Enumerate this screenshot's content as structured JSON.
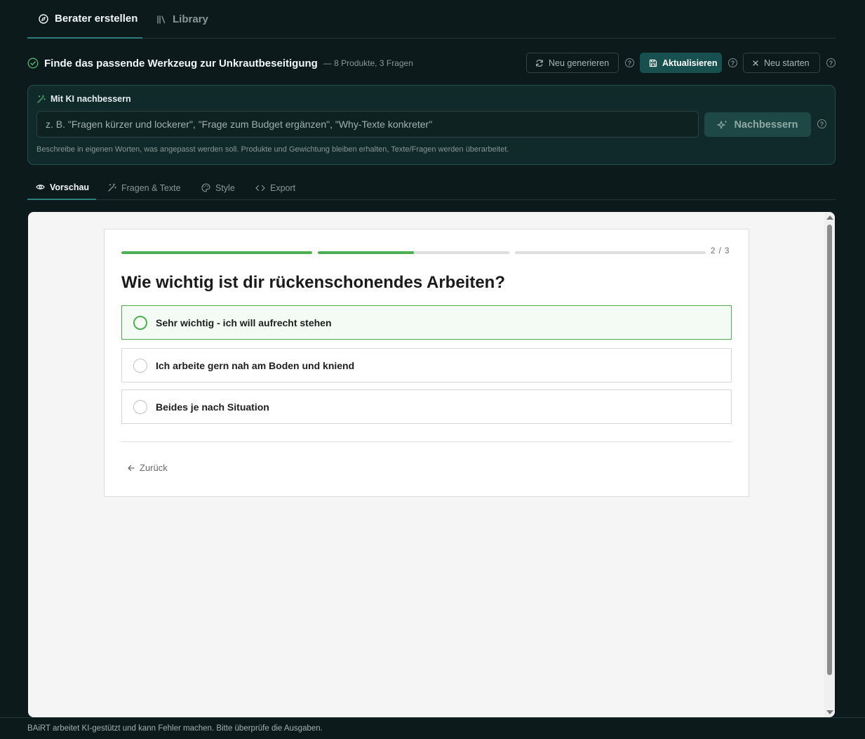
{
  "top_tabs": [
    {
      "label": "Berater erstellen",
      "icon": "compass-icon",
      "active": true
    },
    {
      "label": "Library",
      "icon": "library-icon",
      "active": false
    }
  ],
  "header": {
    "title": "Finde das passende Werkzeug zur Unkrautbeseitigung",
    "subtitle": "— 8 Produkte, 3 Fragen",
    "buttons": {
      "regenerate": "Neu generieren",
      "update": "Aktualisieren",
      "restart": "Neu starten"
    },
    "help_glyph": "?"
  },
  "ai_panel": {
    "label": "Mit KI nachbessern",
    "placeholder": "z. B. \"Fragen kürzer und lockerer\", \"Frage zum Budget ergänzen\", \"Why-Texte konkreter\"",
    "button": "Nachbessern",
    "hint": "Beschreibe in eigenen Worten, was angepasst werden soll. Produkte und Gewichtung bleiben erhalten, Texte/Fragen werden überarbeitet."
  },
  "sub_tabs": [
    {
      "label": "Vorschau",
      "icon": "eye-icon",
      "active": true
    },
    {
      "label": "Fragen & Texte",
      "icon": "wand-icon",
      "active": false
    },
    {
      "label": "Style",
      "icon": "palette-icon",
      "active": false
    },
    {
      "label": "Export",
      "icon": "code-icon",
      "active": false
    }
  ],
  "preview": {
    "progress": [
      1.0,
      0.5,
      0.0
    ],
    "step_counter": "2 / 3",
    "question": "Wie wichtig ist dir rückenschonendes Arbeiten?",
    "options": [
      {
        "label": "Sehr wichtig - ich will aufrecht stehen",
        "selected": true
      },
      {
        "label": "Ich arbeite gern nah am Boden und kniend",
        "selected": false
      },
      {
        "label": "Beides je nach Situation",
        "selected": false
      }
    ],
    "back_label": "Zurück"
  },
  "footer": {
    "text": "BAiRT arbeitet KI-gestützt und kann Fehler machen. Bitte überprüfe die Ausgaben."
  },
  "colors": {
    "background": "#0d1a1b",
    "accent": "#17504f",
    "progress_fill": "#4caf50"
  }
}
